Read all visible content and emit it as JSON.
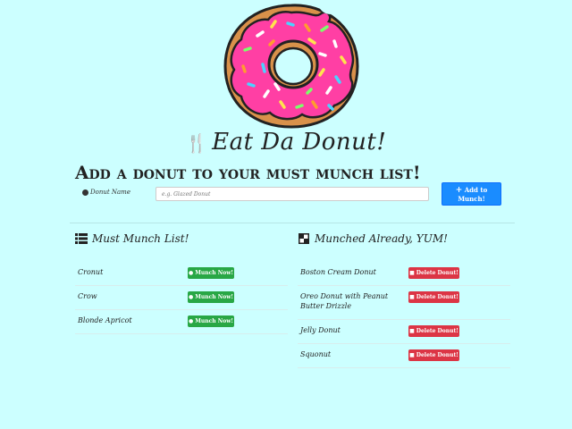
{
  "header": {
    "title": "Eat Da Donut!",
    "logo_icon": "donut-icon",
    "title_icon": "utensils-icon"
  },
  "form": {
    "heading": "Add a donut to your must munch list!",
    "label": "Donut Name",
    "placeholder": "e.g. Glazed Donut",
    "submit_label": "Add to Munch!",
    "submit_icon": "plus-icon"
  },
  "must_munch": {
    "title": "Must Munch List!",
    "icon": "list-icon",
    "items": [
      {
        "name": "Cronut",
        "button": "Munch Now!"
      },
      {
        "name": "Crow",
        "button": "Munch Now!"
      },
      {
        "name": "Blonde Apricot",
        "button": "Munch Now!"
      }
    ]
  },
  "munched": {
    "title": "Munched Already, YUM!",
    "icon": "checkered-icon",
    "items": [
      {
        "name": "Boston Cream Donut",
        "button": "Delete Donut!"
      },
      {
        "name": "Oreo Donut with Peanut Butter Drizzle",
        "button": "Delete Donut!"
      },
      {
        "name": "Jelly Donut",
        "button": "Delete Donut!"
      },
      {
        "name": "Squonut",
        "button": "Delete Donut!"
      }
    ]
  },
  "colors": {
    "background": "#ccffff",
    "primary": "#1a8cff",
    "success": "#28a745",
    "danger": "#dc3545",
    "frosting": "#ff3fa4",
    "dough": "#e8a65a"
  }
}
